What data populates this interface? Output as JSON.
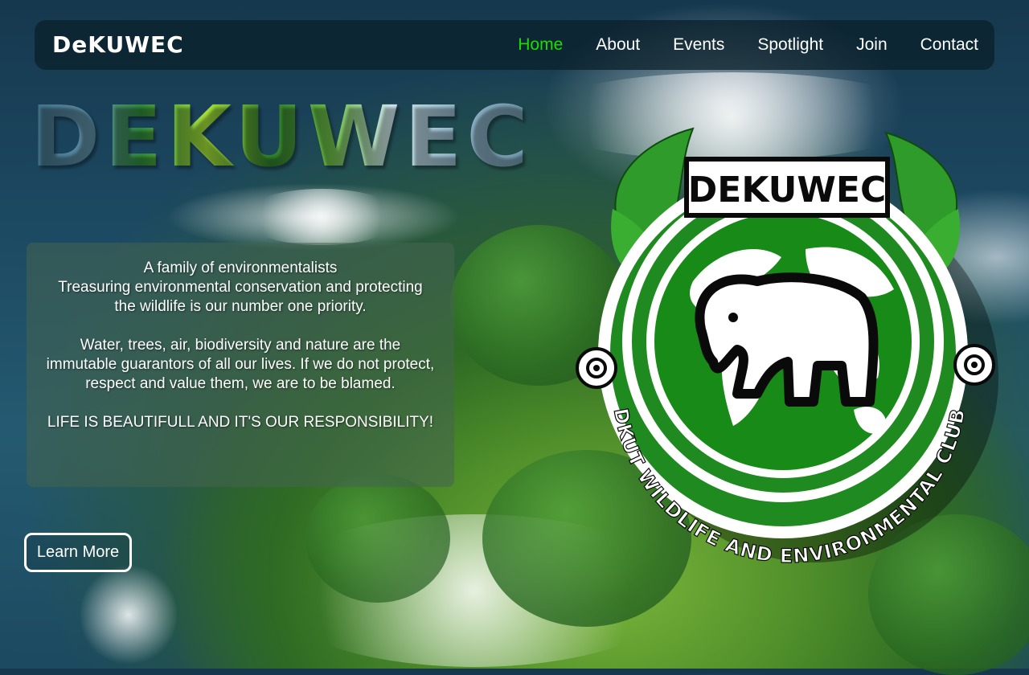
{
  "navbar": {
    "brand": "DeKUWEC",
    "links": [
      {
        "label": "Home",
        "active": true
      },
      {
        "label": "About",
        "active": false
      },
      {
        "label": "Events",
        "active": false
      },
      {
        "label": "Spotlight",
        "active": false
      },
      {
        "label": "Join",
        "active": false
      },
      {
        "label": "Contact",
        "active": false
      }
    ],
    "active_color": "#17e000"
  },
  "hero": {
    "title": "DEKUWEC",
    "intro": {
      "line1": "A family of environmentalists",
      "line2": "Treasuring environmental conservation and protecting the wildlife is our number one priority.",
      "paragraph2": "Water, trees, air, biodiversity and nature are the immutable guarantors of all our lives. If we do not protect, respect and value them, we are to be blamed.",
      "paragraph3": "LIFE IS BEAUTIFULL AND IT'S OUR RESPONSIBILITY!"
    },
    "cta_label": "Learn More"
  },
  "logo": {
    "banner_text": "DEKUWEC",
    "ring_text": "DKUT WILDLIFE AND ENVIRONMENTAL CLUB",
    "colors": {
      "green": "#1f8a1f",
      "dark": "#0a0a0a",
      "white": "#ffffff"
    }
  }
}
